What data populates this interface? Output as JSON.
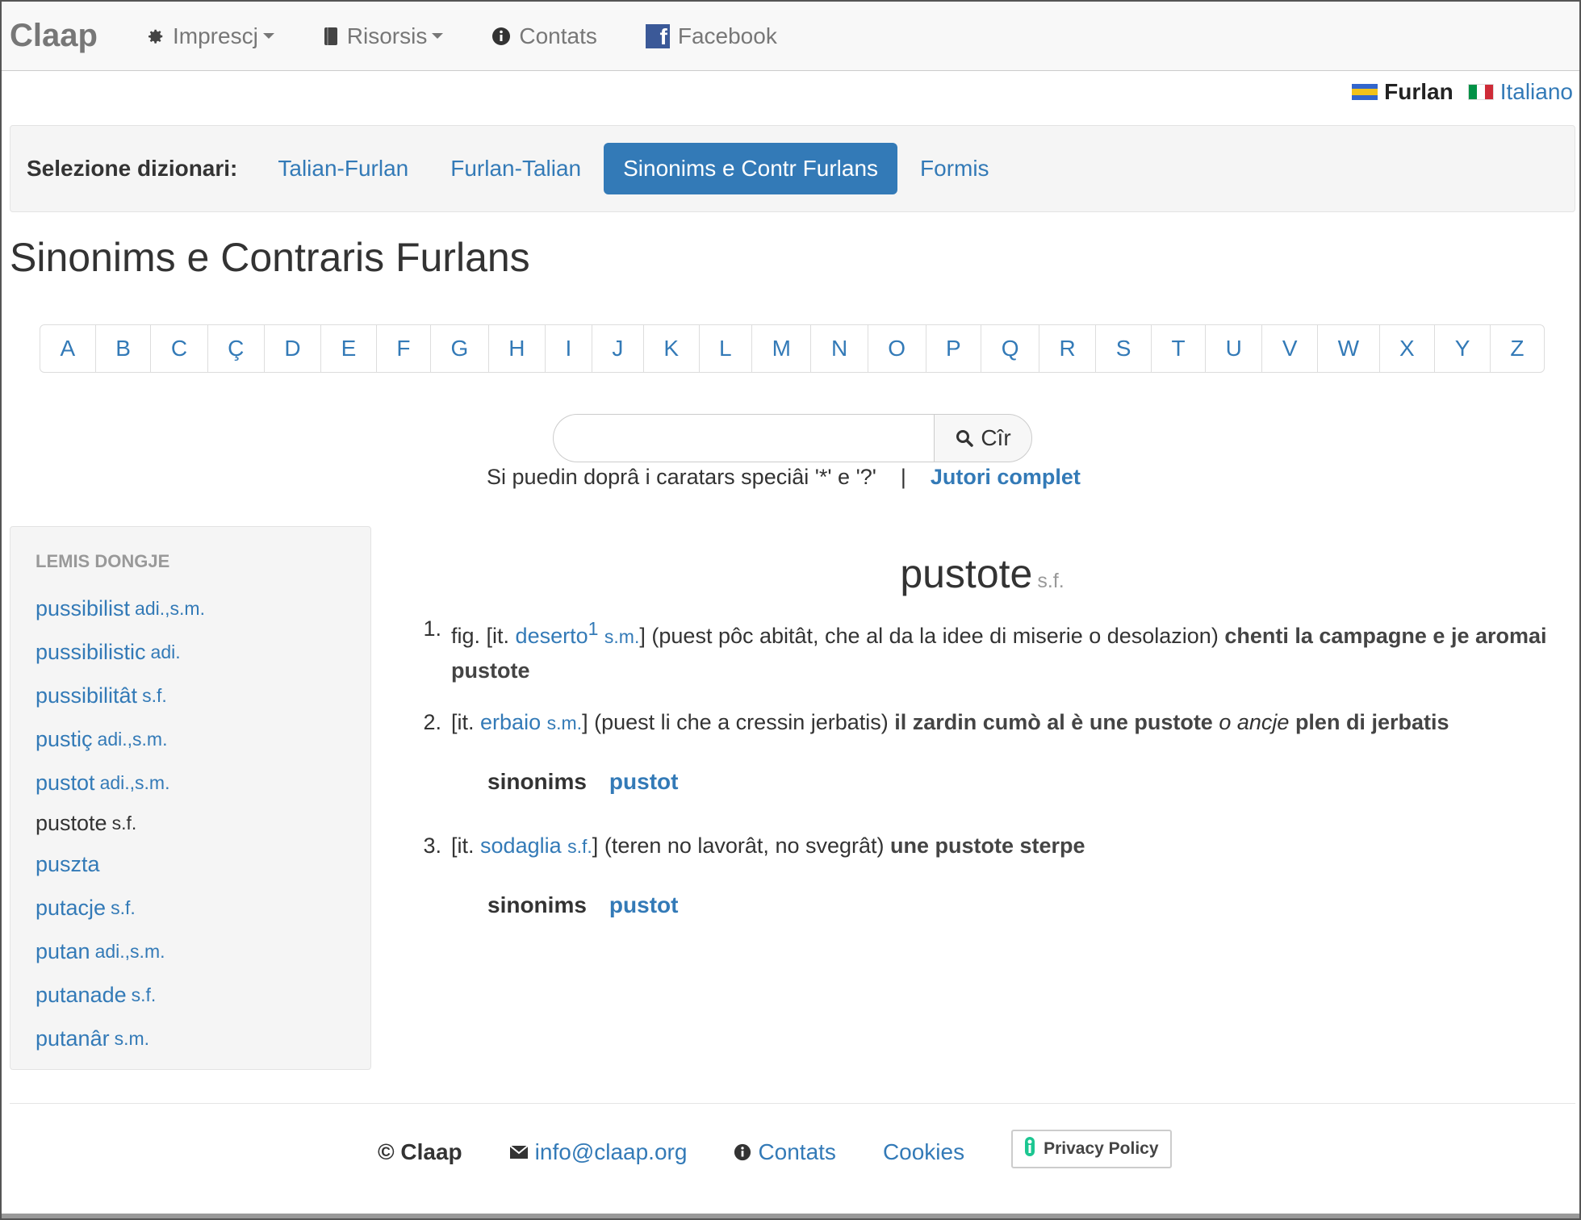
{
  "navbar": {
    "brand": "Claap",
    "items": [
      {
        "label": "Imprescj",
        "icon": "gear-icon",
        "dropdown": true
      },
      {
        "label": "Risorsis",
        "icon": "book-icon",
        "dropdown": true
      },
      {
        "label": "Contats",
        "icon": "info-icon",
        "dropdown": false
      },
      {
        "label": "Facebook",
        "icon": "facebook-icon",
        "dropdown": false
      }
    ]
  },
  "language": {
    "current": "Furlan",
    "other": "Italiano"
  },
  "dictionary_selector": {
    "label": "Selezione dizionari:",
    "tabs": [
      "Talian-Furlan",
      "Furlan-Talian",
      "Sinonims e Contr Furlans",
      "Formis"
    ],
    "active": "Sinonims e Contr Furlans"
  },
  "page_title": "Sinonims e Contraris Furlans",
  "alphabet": [
    "A",
    "B",
    "C",
    "Ç",
    "D",
    "E",
    "F",
    "G",
    "H",
    "I",
    "J",
    "K",
    "L",
    "M",
    "N",
    "O",
    "P",
    "Q",
    "R",
    "S",
    "T",
    "U",
    "V",
    "W",
    "X",
    "Y",
    "Z"
  ],
  "search": {
    "value": "",
    "placeholder": "",
    "button_label": "Cîr",
    "hint": "Si puedin doprâ i caratars speciâi '*' e '?'",
    "separator": "|",
    "help_link": "Jutori complet"
  },
  "sidebar": {
    "heading": "LEMIS DONGJE",
    "items": [
      {
        "word": "pussibilist",
        "pos": "adi.,s.m."
      },
      {
        "word": "pussibilistic",
        "pos": "adi."
      },
      {
        "word": "pussibilitât",
        "pos": "s.f."
      },
      {
        "word": "pustiç",
        "pos": "adi.,s.m."
      },
      {
        "word": "pustot",
        "pos": "adi.,s.m."
      },
      {
        "word": "pustote",
        "pos": "s.f.",
        "current": true
      },
      {
        "word": "puszta",
        "pos": ""
      },
      {
        "word": "putacje",
        "pos": "s.f."
      },
      {
        "word": "putan",
        "pos": "adi.,s.m."
      },
      {
        "word": "putanade",
        "pos": "s.f."
      },
      {
        "word": "putanâr",
        "pos": "s.m."
      }
    ]
  },
  "entry": {
    "headword": "pustote",
    "pos": "s.f.",
    "senses": [
      {
        "num": "1.",
        "prefix": "fig. [it.",
        "it_word": "deserto",
        "sup": "1",
        "it_pos": "s.m.",
        "close": "]",
        "gloss": "(puest pôc abitât, che al da la idee di miserie o desolazion)",
        "example": "chenti la campagne e je aromai pustote"
      },
      {
        "num": "2.",
        "prefix": "[it.",
        "it_word": "erbaio",
        "it_pos": "s.m.",
        "close": "]",
        "gloss": "(puest li che a cressin jerbatis)",
        "example": "il zardin cumò al è une pustote",
        "example_alt_conj": "o ancje",
        "example_alt": "plen di jerbatis",
        "synonyms_label": "sinonims",
        "synonym": "pustot"
      },
      {
        "num": "3.",
        "prefix": "[it.",
        "it_word": "sodaglia",
        "it_pos": "s.f.",
        "close": "]",
        "gloss": "(teren no lavorât, no svegrât)",
        "example": "une pustote sterpe",
        "synonyms_label": "sinonims",
        "synonym": "pustot"
      }
    ]
  },
  "footer": {
    "copyright": "© Claap",
    "email": "info@claap.org",
    "contacts": "Contats",
    "cookies": "Cookies",
    "privacy": "Privacy Policy"
  },
  "colors": {
    "link": "#337ab7",
    "active_tab_bg": "#337ab7",
    "muted": "#999999"
  }
}
